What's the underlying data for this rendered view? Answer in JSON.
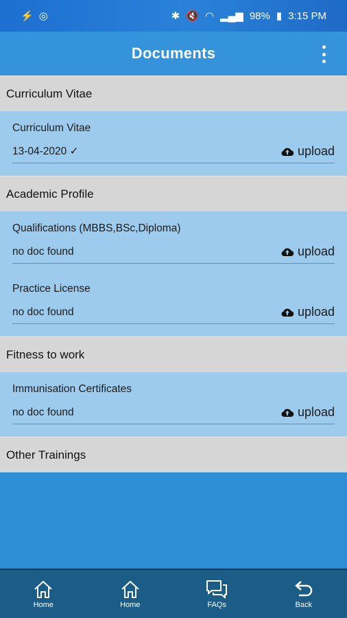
{
  "status_bar": {
    "battery": "98%",
    "time": "3:15 PM"
  },
  "app_bar": {
    "title": "Documents"
  },
  "sections": [
    {
      "title": "Curriculum Vitae",
      "items": [
        {
          "name": "Curriculum Vitae",
          "status": "13-04-2020 ✓",
          "action": "upload"
        }
      ]
    },
    {
      "title": "Academic Profile",
      "items": [
        {
          "name": "Qualifications (MBBS,BSc,Diploma)",
          "status": "no doc found",
          "action": "upload"
        },
        {
          "name": "Practice License",
          "status": "no doc found",
          "action": "upload"
        }
      ]
    },
    {
      "title": "Fitness to work",
      "items": [
        {
          "name": "Immunisation Certificates",
          "status": "no doc found",
          "action": "upload"
        }
      ]
    },
    {
      "title": "Other Trainings",
      "items": []
    }
  ],
  "bottom_nav": [
    {
      "label": "Home",
      "icon": "home-icon"
    },
    {
      "label": "Home",
      "icon": "home-icon"
    },
    {
      "label": "FAQs",
      "icon": "chat-icon"
    },
    {
      "label": "Back",
      "icon": "back-arrow-icon"
    }
  ]
}
